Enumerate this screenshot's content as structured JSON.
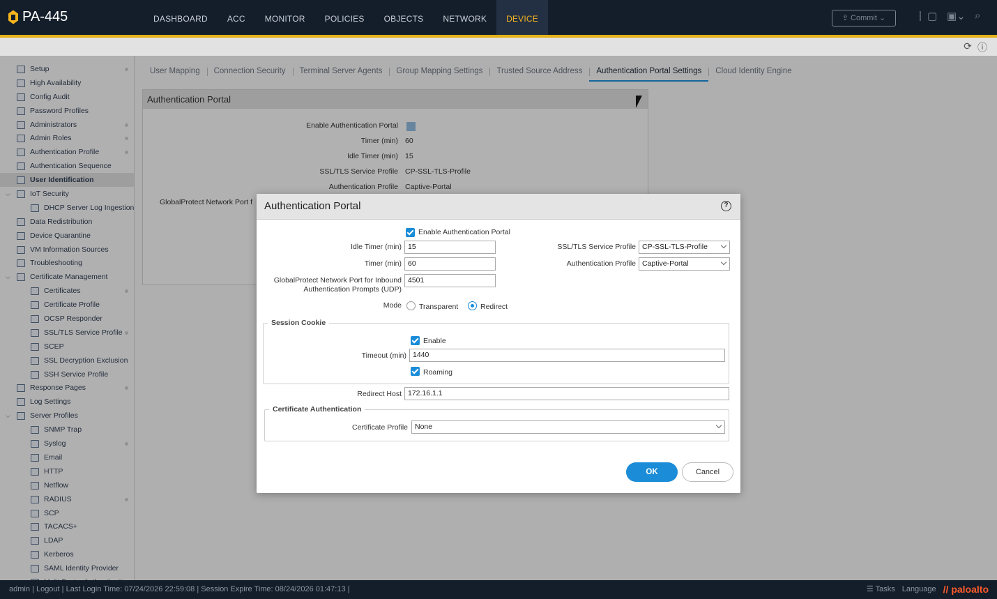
{
  "topbar": {
    "logo": "PA-445",
    "nav": [
      "DASHBOARD",
      "ACC",
      "MONITOR",
      "POLICIES",
      "OBJECTS",
      "NETWORK",
      "DEVICE"
    ],
    "active_nav": "DEVICE",
    "commit_label": "Commit"
  },
  "sidebar": {
    "items": [
      {
        "label": "Setup",
        "indent": 0,
        "dot": true
      },
      {
        "label": "High Availability",
        "indent": 0
      },
      {
        "label": "Config Audit",
        "indent": 0
      },
      {
        "label": "Password Profiles",
        "indent": 0
      },
      {
        "label": "Administrators",
        "indent": 0,
        "dot": true
      },
      {
        "label": "Admin Roles",
        "indent": 0,
        "dot": true
      },
      {
        "label": "Authentication Profile",
        "indent": 0,
        "dot": true
      },
      {
        "label": "Authentication Sequence",
        "indent": 0
      },
      {
        "label": "User Identification",
        "indent": 0,
        "selected": true
      },
      {
        "label": "IoT Security",
        "indent": 0,
        "chev": true
      },
      {
        "label": "DHCP Server Log Ingestion",
        "indent": 1
      },
      {
        "label": "Data Redistribution",
        "indent": 0
      },
      {
        "label": "Device Quarantine",
        "indent": 0
      },
      {
        "label": "VM Information Sources",
        "indent": 0
      },
      {
        "label": "Troubleshooting",
        "indent": 0
      },
      {
        "label": "Certificate Management",
        "indent": 0,
        "chev": true
      },
      {
        "label": "Certificates",
        "indent": 1,
        "dot": true
      },
      {
        "label": "Certificate Profile",
        "indent": 1
      },
      {
        "label": "OCSP Responder",
        "indent": 1
      },
      {
        "label": "SSL/TLS Service Profile",
        "indent": 1,
        "dot": true
      },
      {
        "label": "SCEP",
        "indent": 1
      },
      {
        "label": "SSL Decryption Exclusion",
        "indent": 1
      },
      {
        "label": "SSH Service Profile",
        "indent": 1
      },
      {
        "label": "Response Pages",
        "indent": 0,
        "dot": true
      },
      {
        "label": "Log Settings",
        "indent": 0
      },
      {
        "label": "Server Profiles",
        "indent": 0,
        "chev": true
      },
      {
        "label": "SNMP Trap",
        "indent": 1
      },
      {
        "label": "Syslog",
        "indent": 1,
        "dot": true
      },
      {
        "label": "Email",
        "indent": 1
      },
      {
        "label": "HTTP",
        "indent": 1
      },
      {
        "label": "Netflow",
        "indent": 1
      },
      {
        "label": "RADIUS",
        "indent": 1,
        "dot": true
      },
      {
        "label": "SCP",
        "indent": 1
      },
      {
        "label": "TACACS+",
        "indent": 1
      },
      {
        "label": "LDAP",
        "indent": 1
      },
      {
        "label": "Kerberos",
        "indent": 1
      },
      {
        "label": "SAML Identity Provider",
        "indent": 1
      },
      {
        "label": "Multi Factor Authentication",
        "indent": 1
      }
    ]
  },
  "tabs": [
    "User Mapping",
    "Connection Security",
    "Terminal Server Agents",
    "Group Mapping Settings",
    "Trusted Source Address",
    "Authentication Portal Settings",
    "Cloud Identity Engine"
  ],
  "active_tab": "Authentication Portal Settings",
  "background_panel": {
    "title": "Authentication Portal",
    "rows": [
      {
        "label": "Enable Authentication Portal",
        "value": ""
      },
      {
        "label": "Timer (min)",
        "value": "60"
      },
      {
        "label": "Idle Timer (min)",
        "value": "15"
      },
      {
        "label": "SSL/TLS Service Profile",
        "value": "CP-SSL-TLS-Profile"
      },
      {
        "label": "Authentication Profile",
        "value": "Captive-Portal"
      },
      {
        "label": "GlobalProtect Network Port f",
        "value": ""
      }
    ]
  },
  "dialog": {
    "title": "Authentication Portal",
    "enable_label": "Enable Authentication Portal",
    "idle_timer_label": "Idle Timer (min)",
    "idle_timer_value": "15",
    "timer_label": "Timer (min)",
    "timer_value": "60",
    "gp_port_label_1": "GlobalProtect Network Port for Inbound",
    "gp_port_label_2": "Authentication Prompts (UDP)",
    "gp_port_value": "4501",
    "ssl_label": "SSL/TLS Service Profile",
    "ssl_value": "CP-SSL-TLS-Profile",
    "auth_profile_label": "Authentication Profile",
    "auth_profile_value": "Captive-Portal",
    "mode_label": "Mode",
    "mode_transparent": "Transparent",
    "mode_redirect": "Redirect",
    "session_cookie": {
      "legend": "Session Cookie",
      "enable_label": "Enable",
      "timeout_label": "Timeout (min)",
      "timeout_value": "1440",
      "roaming_label": "Roaming"
    },
    "redirect_host_label": "Redirect Host",
    "redirect_host_value": "172.16.1.1",
    "cert_auth": {
      "legend": "Certificate Authentication",
      "profile_label": "Certificate Profile",
      "profile_value": "None"
    },
    "ok_label": "OK",
    "cancel_label": "Cancel"
  },
  "status": {
    "user": "admin",
    "logout": "Logout",
    "last_login": "Last Login Time: 07/24/2026 22:59:08",
    "session_expire": "Session Expire Time: 08/24/2026 01:47:13",
    "tasks": "Tasks",
    "language": "Language",
    "brand": "paloalto"
  },
  "colors": {
    "accent": "#1a8cd8",
    "nav_active": "#f6b51d",
    "topbar": "#141e2b"
  }
}
